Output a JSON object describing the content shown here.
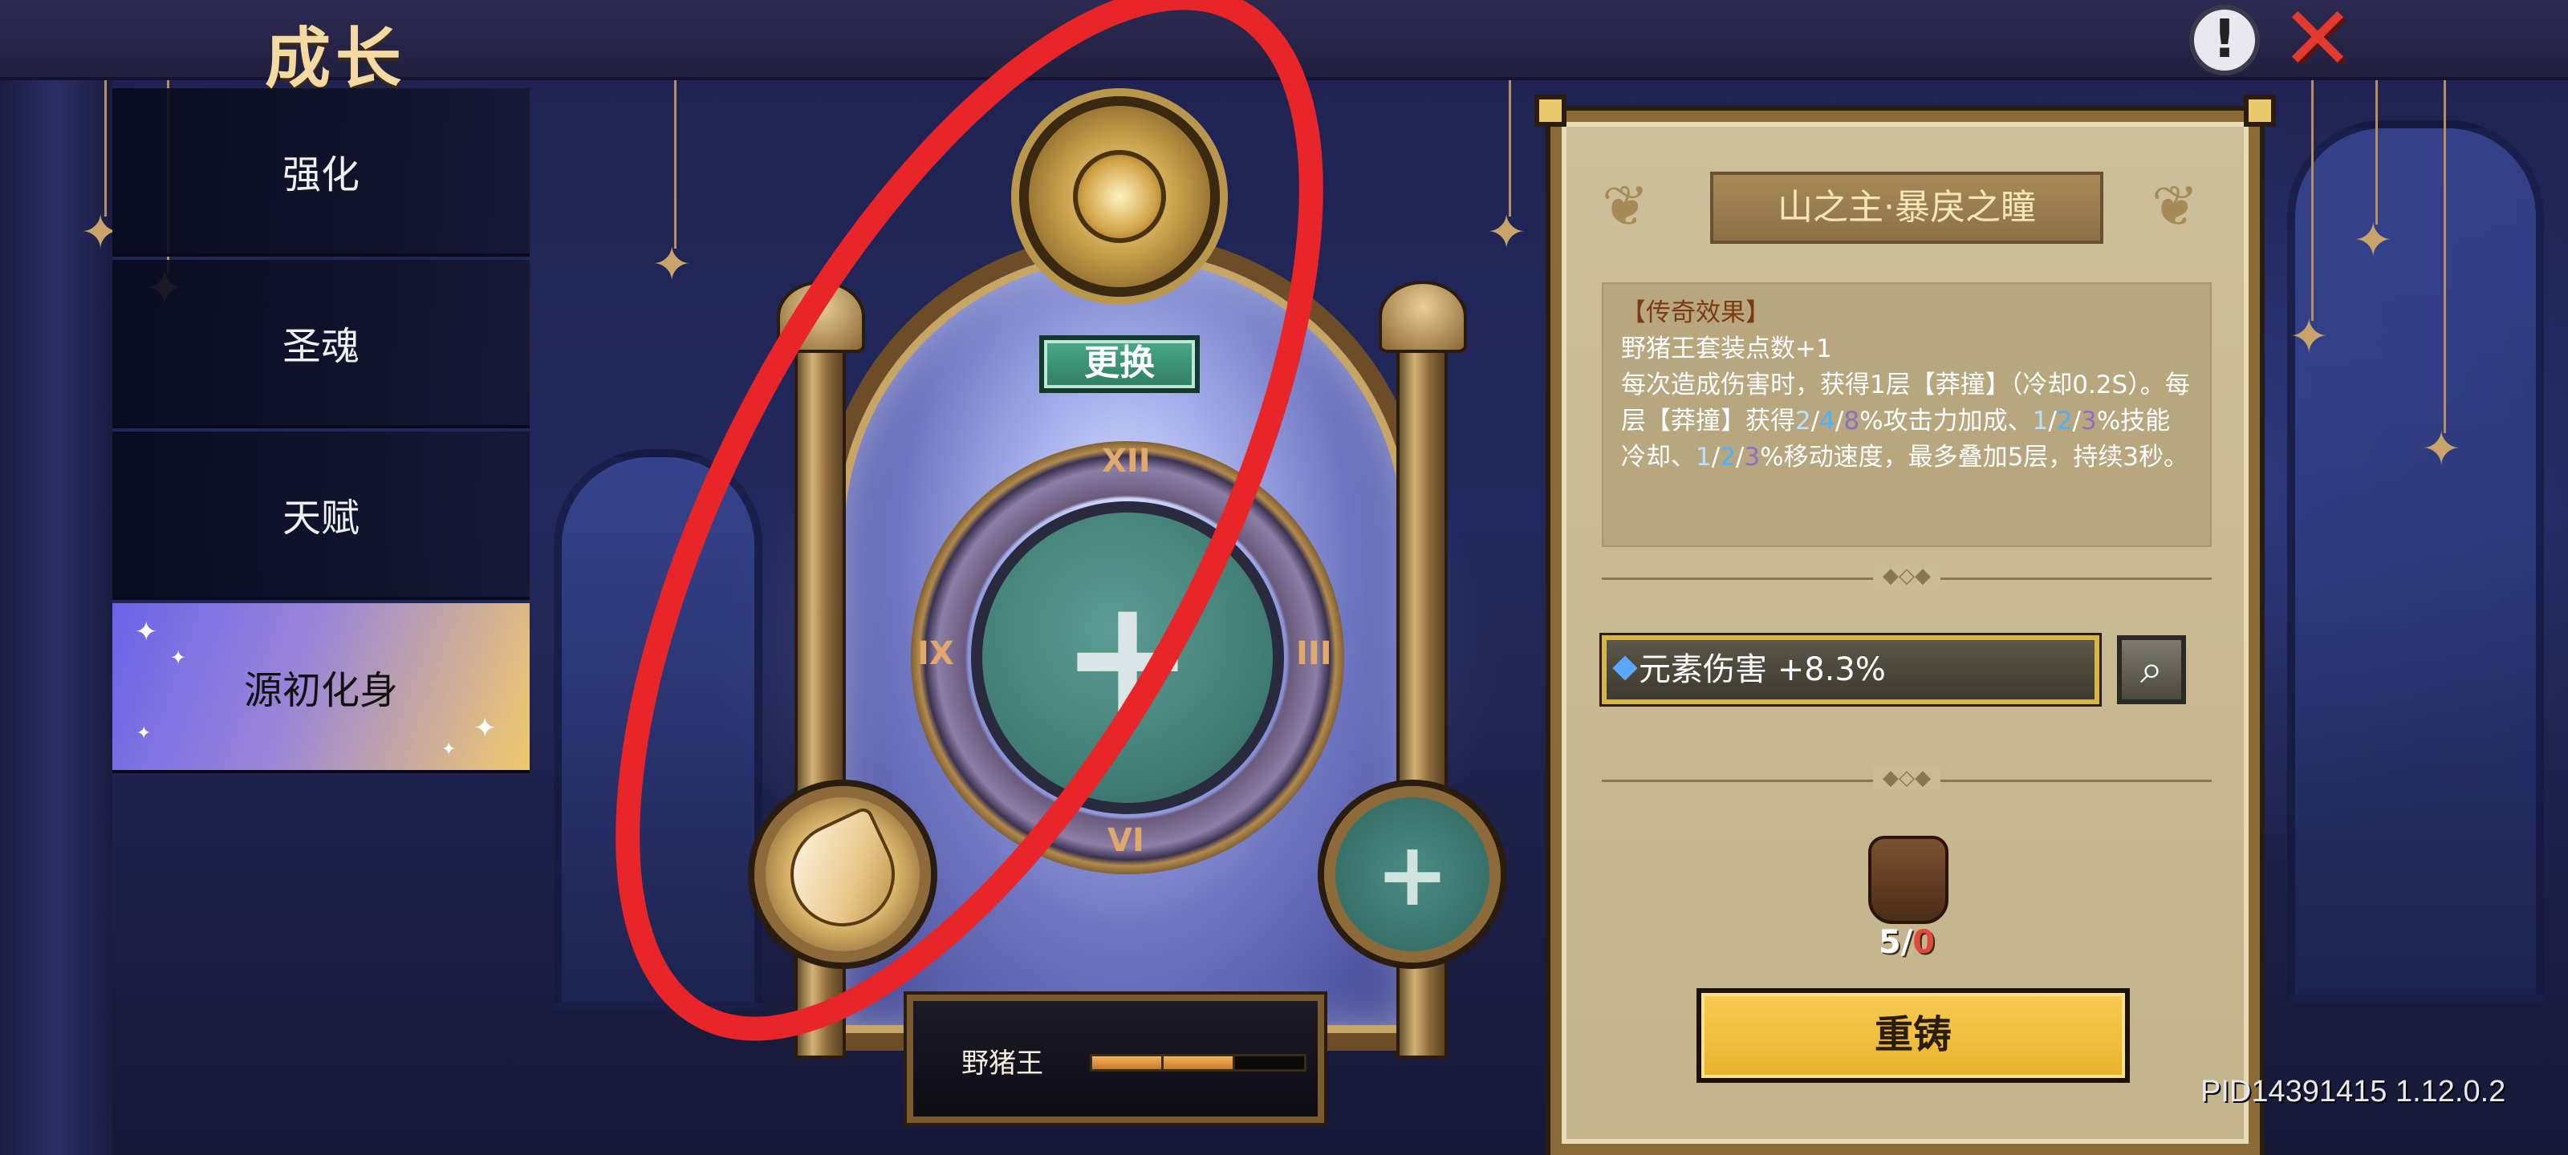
{
  "header": {
    "title": "成长",
    "info_icon": "exclamation-icon",
    "close_icon": "close-x-icon"
  },
  "sidebar": {
    "items": [
      {
        "label": "强化",
        "active": false
      },
      {
        "label": "圣魂",
        "active": false
      },
      {
        "label": "天赋",
        "active": false
      },
      {
        "label": "源初化身",
        "active": true
      }
    ]
  },
  "altar": {
    "swap_label": "更换",
    "clock_numerals": [
      "XII",
      "III",
      "VI",
      "IX"
    ],
    "set_name": "野猪王",
    "set_progress": {
      "filled": 2,
      "total": 3
    }
  },
  "detail": {
    "item_name": "山之主·暴戾之瞳",
    "effect_title": "【传奇效果】",
    "effect_line1": "野猪王套装点数+1",
    "effect_p1": "每次造成伤害时，获得1层【莽撞】（冷却0.2S）。每层【莽撞】获得",
    "effect_v1a": "2",
    "effect_v1b": "4",
    "effect_v1c": "8",
    "effect_p2": "%攻击力加成、",
    "effect_v2a": "1",
    "effect_v2b": "2",
    "effect_v2c": "3",
    "effect_p3": "%技能冷却、",
    "effect_v3a": "1",
    "effect_v3b": "2",
    "effect_v3c": "3",
    "effect_p4": "%移动速度，最多叠加5层，持续3秒。",
    "divider_glyph": "◆◇◆",
    "stat_text": "元素伤害 +8.3%",
    "zoom_icon": "magnifier-icon",
    "material_have": "5",
    "material_sep": "/",
    "material_need": "0",
    "reforge_label": "重铸"
  },
  "footer": {
    "version": "PID14391415 1.12.0.2"
  },
  "colors": {
    "active_menu_start": "#6b63e8",
    "active_menu_end": "#f0c96c",
    "swap_button": "#3a9a7a",
    "reforge_button": "#f0c23c",
    "annotation": "#e8262a",
    "close_icon": "#e23a2e"
  }
}
